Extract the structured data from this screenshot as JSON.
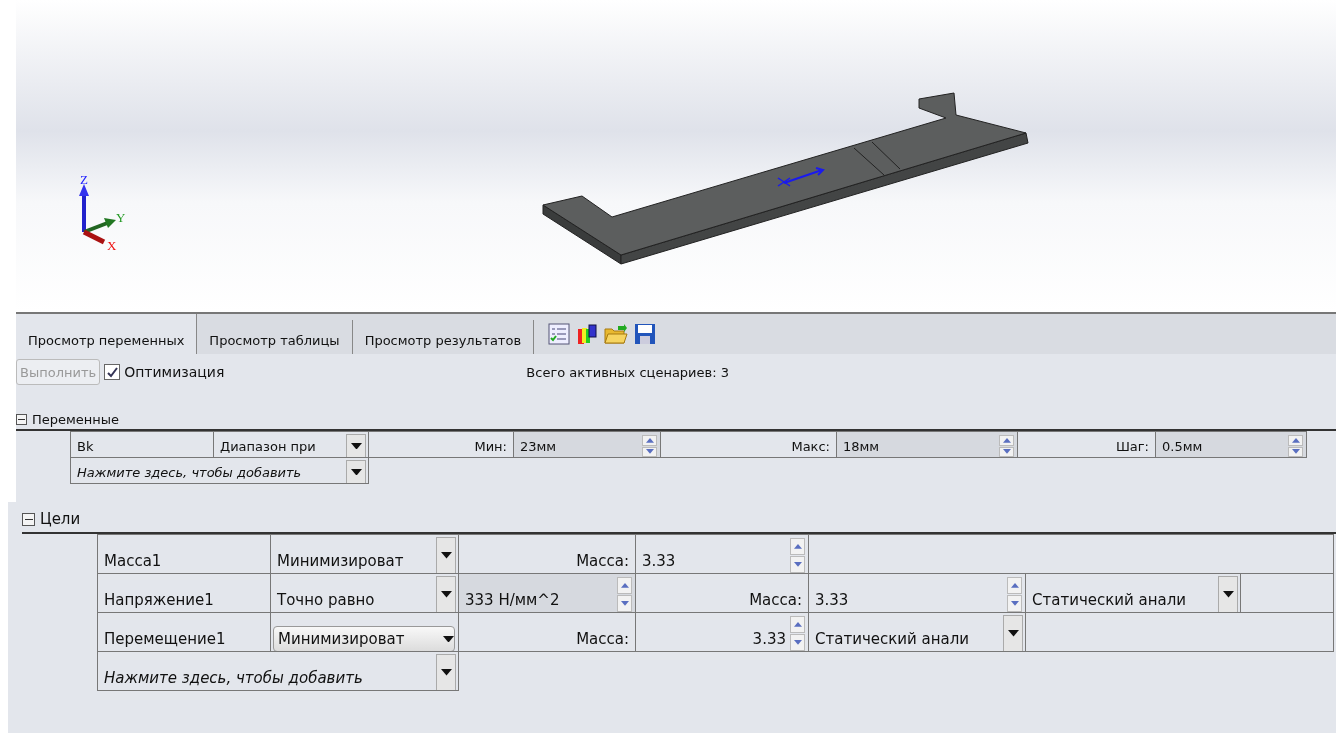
{
  "viewport": {
    "axes": [
      "X",
      "Y",
      "Z"
    ]
  },
  "tabs": [
    {
      "label": "Просмотр переменных",
      "selected": true
    },
    {
      "label": "Просмотр таблицы",
      "selected": false
    },
    {
      "label": "Просмотр результатов",
      "selected": false
    }
  ],
  "run_button": {
    "label": "Выполнить",
    "disabled": true
  },
  "optimization": {
    "label": "Оптимизация",
    "checked": true
  },
  "scenarios": {
    "label": "Всего активных сценариев:",
    "value": "3"
  },
  "variables": {
    "title": "Переменные",
    "expanded": true,
    "rows": [
      [
        {
          "kind": "text",
          "text": "Bk"
        },
        {
          "kind": "dropdown",
          "text": "Диапазон при"
        },
        {
          "kind": "label",
          "text": "Мин:"
        },
        {
          "kind": "spinner",
          "text": "23мм",
          "shaded": true,
          "right_aligned": false
        },
        {
          "kind": "label",
          "text": "Макс:"
        },
        {
          "kind": "spinner",
          "text": "18мм",
          "shaded": true,
          "right_aligned": false
        },
        {
          "kind": "label",
          "text": "Шаг:"
        },
        {
          "kind": "spinner",
          "text": "0.5мм",
          "shaded": true,
          "right_aligned": false
        }
      ],
      [
        {
          "kind": "add",
          "text": "Нажмите здесь, чтобы добавить"
        }
      ]
    ]
  },
  "goals": {
    "title": "Цели",
    "expanded": true,
    "rows": [
      [
        {
          "kind": "text",
          "text": "Масса1"
        },
        {
          "kind": "dropdown",
          "text": "Минимизироват",
          "focused": false
        },
        {
          "kind": "label",
          "text": "Масса:"
        },
        {
          "kind": "spinner",
          "text": "3.33",
          "shaded": false,
          "right_aligned": false
        },
        {
          "kind": "empty"
        }
      ],
      [
        {
          "kind": "text",
          "text": "Напряжение1"
        },
        {
          "kind": "dropdown",
          "text": "Точно равно",
          "focused": false
        },
        {
          "kind": "spinner",
          "text": "333 Н/мм^2",
          "shaded": true,
          "right_aligned": false
        },
        {
          "kind": "label",
          "text": "Масса:"
        },
        {
          "kind": "spinner",
          "text": "3.33",
          "shaded": false,
          "right_aligned": false
        },
        {
          "kind": "dropdown",
          "text": "Статический анали",
          "focused": false
        },
        {
          "kind": "empty"
        }
      ],
      [
        {
          "kind": "text",
          "text": "Перемещение1"
        },
        {
          "kind": "dropdown",
          "text": "Минимизироват",
          "focused": true
        },
        {
          "kind": "label",
          "text": "Масса:"
        },
        {
          "kind": "spinner",
          "text": "3.33",
          "shaded": false,
          "right_aligned": true
        },
        {
          "kind": "dropdown",
          "text": "Статический анали",
          "focused": false
        },
        {
          "kind": "empty"
        }
      ],
      [
        {
          "kind": "add",
          "text": "Нажмите здесь, чтобы добавить"
        }
      ]
    ]
  }
}
